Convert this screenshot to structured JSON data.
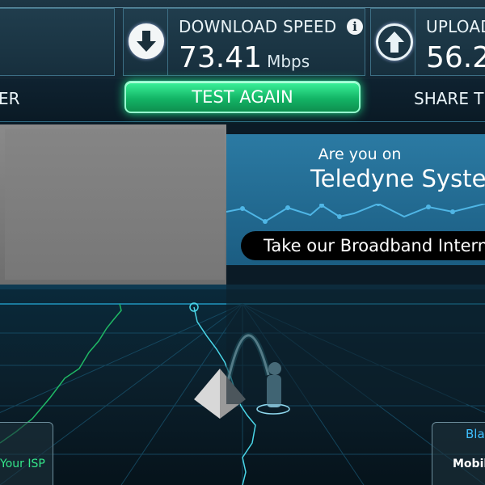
{
  "metrics": {
    "download": {
      "label": "DOWNLOAD SPEED",
      "value": "73.41",
      "unit": "Mbps"
    },
    "upload": {
      "label": "UPLOAD",
      "value": "56.2"
    }
  },
  "actions": {
    "left_label": "ER",
    "test_again_label": "TEST AGAIN",
    "share_label": "SHARE TH"
  },
  "ad": {
    "question": "Are you on",
    "company": "Teledyne System",
    "cta": "Take our Broadband Interne"
  },
  "scene": {
    "isp_label": "Your ISP",
    "right_top": "Bla",
    "right_bottom": "Mobile"
  },
  "colors": {
    "accent_green": "#13b566",
    "ad_blue": "#2b7aa3",
    "isp_green": "#34e68a"
  }
}
